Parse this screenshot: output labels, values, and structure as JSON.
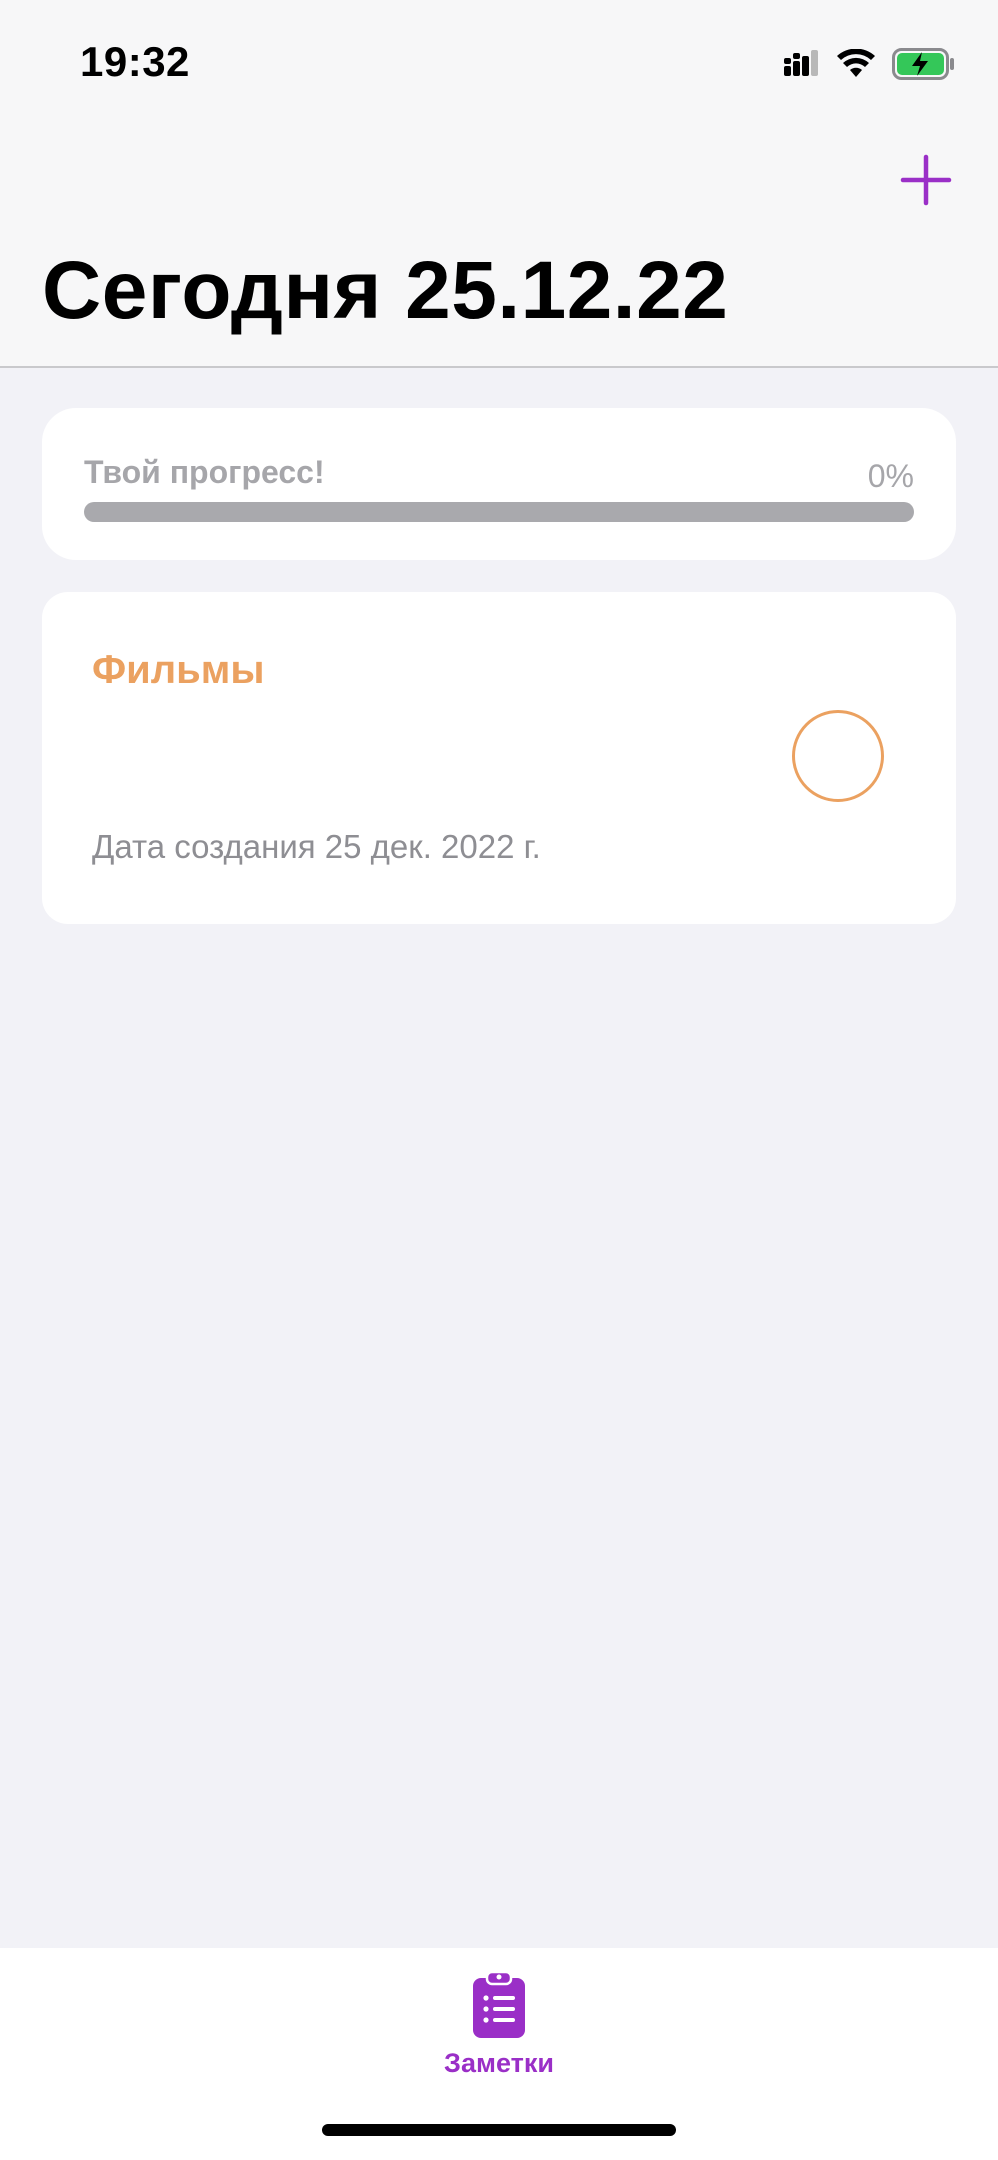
{
  "status_bar": {
    "time": "19:32",
    "icons": [
      "cellular-signal-icon",
      "wifi-icon",
      "battery-charging-icon"
    ]
  },
  "nav": {
    "add_icon": "plus-icon",
    "title": "Сегодня 25.12.22"
  },
  "progress": {
    "label": "Твой прогресс!",
    "percent_text": "0%",
    "value": 0
  },
  "notes": [
    {
      "title": "Фильмы",
      "date": "Дата создания 25 дек. 2022 г.",
      "completed": false
    }
  ],
  "tabbar": {
    "items": [
      {
        "label": "Заметки",
        "icon": "clipboard-list-icon",
        "selected": true
      }
    ]
  },
  "colors": {
    "accent": "#9a2fc7",
    "note_accent": "#eba160",
    "background": "#f2f2f7",
    "muted_text": "#a6a6aa"
  }
}
